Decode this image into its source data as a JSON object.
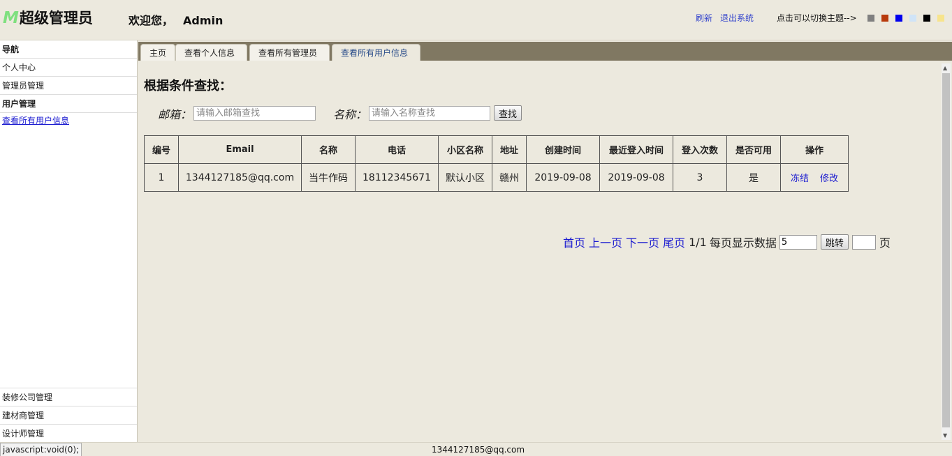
{
  "header": {
    "logo_mark": "M",
    "logo_text": "超级管理员",
    "welcome": "欢迎您，",
    "user": "Admin",
    "refresh": "刷新",
    "logout": "退出系统",
    "theme_hint": "点击可以切换主题-->",
    "theme_colors": [
      "#808080",
      "#b83a0c",
      "#0000ee",
      "#d0e4f7",
      "#000000",
      "#f7e48c"
    ]
  },
  "sidebar": {
    "nav_title": "导航",
    "items": [
      "个人中心",
      "管理员管理",
      "用户管理"
    ],
    "sub_link": "查看所有用户信息",
    "bottom_items": [
      "装修公司管理",
      "建材商管理",
      "设计师管理"
    ]
  },
  "tabs": [
    "主页",
    "查看个人信息",
    "查看所有管理员",
    "查看所有用户信息"
  ],
  "search": {
    "title": "根据条件查找：",
    "email_label": "邮箱：",
    "email_placeholder": "请输入邮箱查找",
    "name_label": "名称：",
    "name_placeholder": "请输入名称查找",
    "search_button": "查找"
  },
  "table": {
    "headers": [
      "编号",
      "Email",
      "名称",
      "电话",
      "小区名称",
      "地址",
      "创建时间",
      "最近登入时间",
      "登入次数",
      "是否可用",
      "操作"
    ],
    "rows": [
      {
        "id": "1",
        "email": "1344127185@qq.com",
        "name": "当牛作码",
        "phone": "18112345671",
        "community": "默认小区",
        "address": "赣州",
        "created": "2019-09-08",
        "last_login": "2019-09-08",
        "login_count": "3",
        "enabled": "是",
        "action_freeze": "冻结",
        "action_edit": "修改"
      }
    ]
  },
  "pager": {
    "first": "首页",
    "prev": "上一页",
    "next": "下一页",
    "last": "尾页",
    "page_info": "1/1",
    "per_page_label": "每页显示数据",
    "per_page_value": "5",
    "jump_button": "跳转",
    "page_suffix": "页"
  },
  "status": {
    "left": "javascript:void(0);",
    "center": "1344127185@qq.com"
  }
}
